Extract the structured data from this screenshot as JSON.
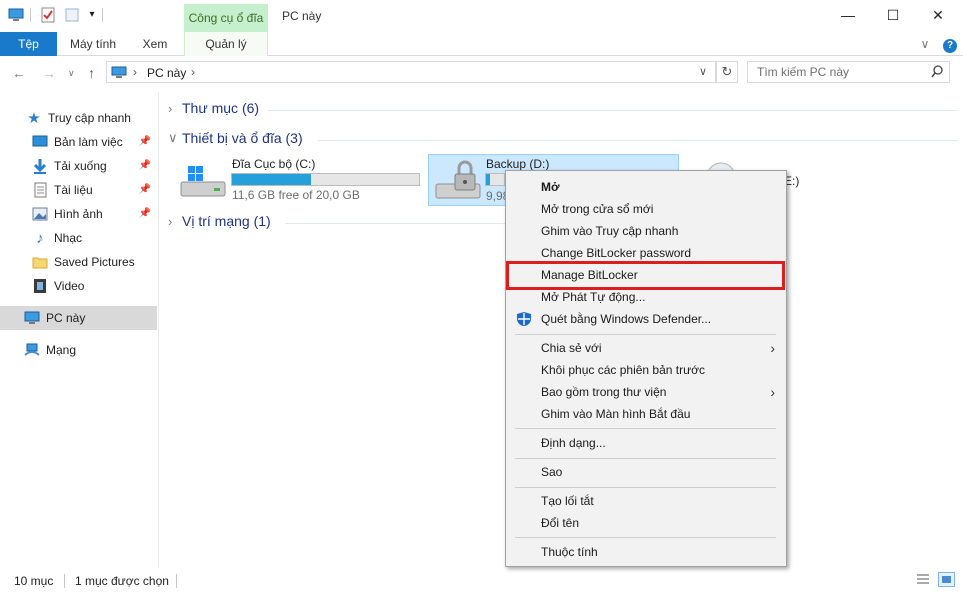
{
  "titlebar": {
    "contextual_tab": "Công cụ ổ đĩa",
    "title": "PC này",
    "minimize": "—",
    "maximize": "☐",
    "close": "✕"
  },
  "ribbon": {
    "tabs": [
      "Tệp",
      "Máy tính",
      "Xem",
      "Quản lý"
    ],
    "collapse": "∨",
    "help": "?"
  },
  "address": {
    "path": "PC này",
    "separator": "›",
    "dropdown": "∨",
    "refresh": "↻",
    "search_placeholder": "Tìm kiếm PC này"
  },
  "sidebar": {
    "quick_access": "Truy cập nhanh",
    "items": [
      {
        "label": "Bản làm việc",
        "icon": "desktop-icon",
        "pinned": true
      },
      {
        "label": "Tải xuống",
        "icon": "download-icon",
        "pinned": true
      },
      {
        "label": "Tài liệu",
        "icon": "document-icon",
        "pinned": true
      },
      {
        "label": "Hình ảnh",
        "icon": "picture-icon",
        "pinned": true
      },
      {
        "label": "Nhạc",
        "icon": "music-icon",
        "pinned": false
      },
      {
        "label": "Saved Pictures",
        "icon": "folder-icon",
        "pinned": false
      },
      {
        "label": "Video",
        "icon": "video-icon",
        "pinned": false
      }
    ],
    "this_pc": "PC này",
    "network": "Mạng"
  },
  "content": {
    "groups": [
      {
        "label": "Thư mục (6)",
        "expanded": false
      },
      {
        "label": "Thiết bị và ổ đĩa (3)",
        "expanded": true
      },
      {
        "label": "Vị trí mạng (1)",
        "expanded": false
      }
    ],
    "drives": [
      {
        "name": "Đĩa Cục bộ (C:)",
        "free_text": "11,6 GB free of 20,0 GB",
        "used_fraction": 0.42
      },
      {
        "name": "Backup (D:)",
        "free_text": "9,98",
        "used_fraction": 0.02
      }
    ],
    "third_drive_suffix": "(E:)"
  },
  "context_menu": {
    "items": [
      {
        "label": "Mở",
        "bold": true
      },
      {
        "label": "Mở trong cửa sổ mới"
      },
      {
        "label": "Ghim vào Truy cập nhanh"
      },
      {
        "label": "Change BitLocker password"
      },
      {
        "label": "Manage BitLocker",
        "highlighted": true
      },
      {
        "label": "Mở Phát Tự động..."
      },
      {
        "label": "Quét bằng Windows Defender...",
        "icon": "windows-defender-icon"
      },
      {
        "label": "Chia sẻ với",
        "submenu": true
      },
      {
        "label": "Khôi phục các phiên bản trước"
      },
      {
        "label": "Bao gồm trong thư viện",
        "submenu": true
      },
      {
        "label": "Ghim vào Màn hình Bắt đầu"
      },
      {
        "label": "Định dạng..."
      },
      {
        "label": "Sao"
      },
      {
        "label": "Tạo lối tắt"
      },
      {
        "label": "Đổi tên"
      },
      {
        "label": "Thuộc tính"
      }
    ],
    "submenu_arrow": "›"
  },
  "status": {
    "item_count": "10 mục",
    "selected": "1 mục được chọn"
  },
  "colors": {
    "accent": "#1979ca",
    "drive_bar": "#26a0da",
    "highlight_box": "#dc1e1e",
    "contextual_tab": "#c6efce"
  }
}
